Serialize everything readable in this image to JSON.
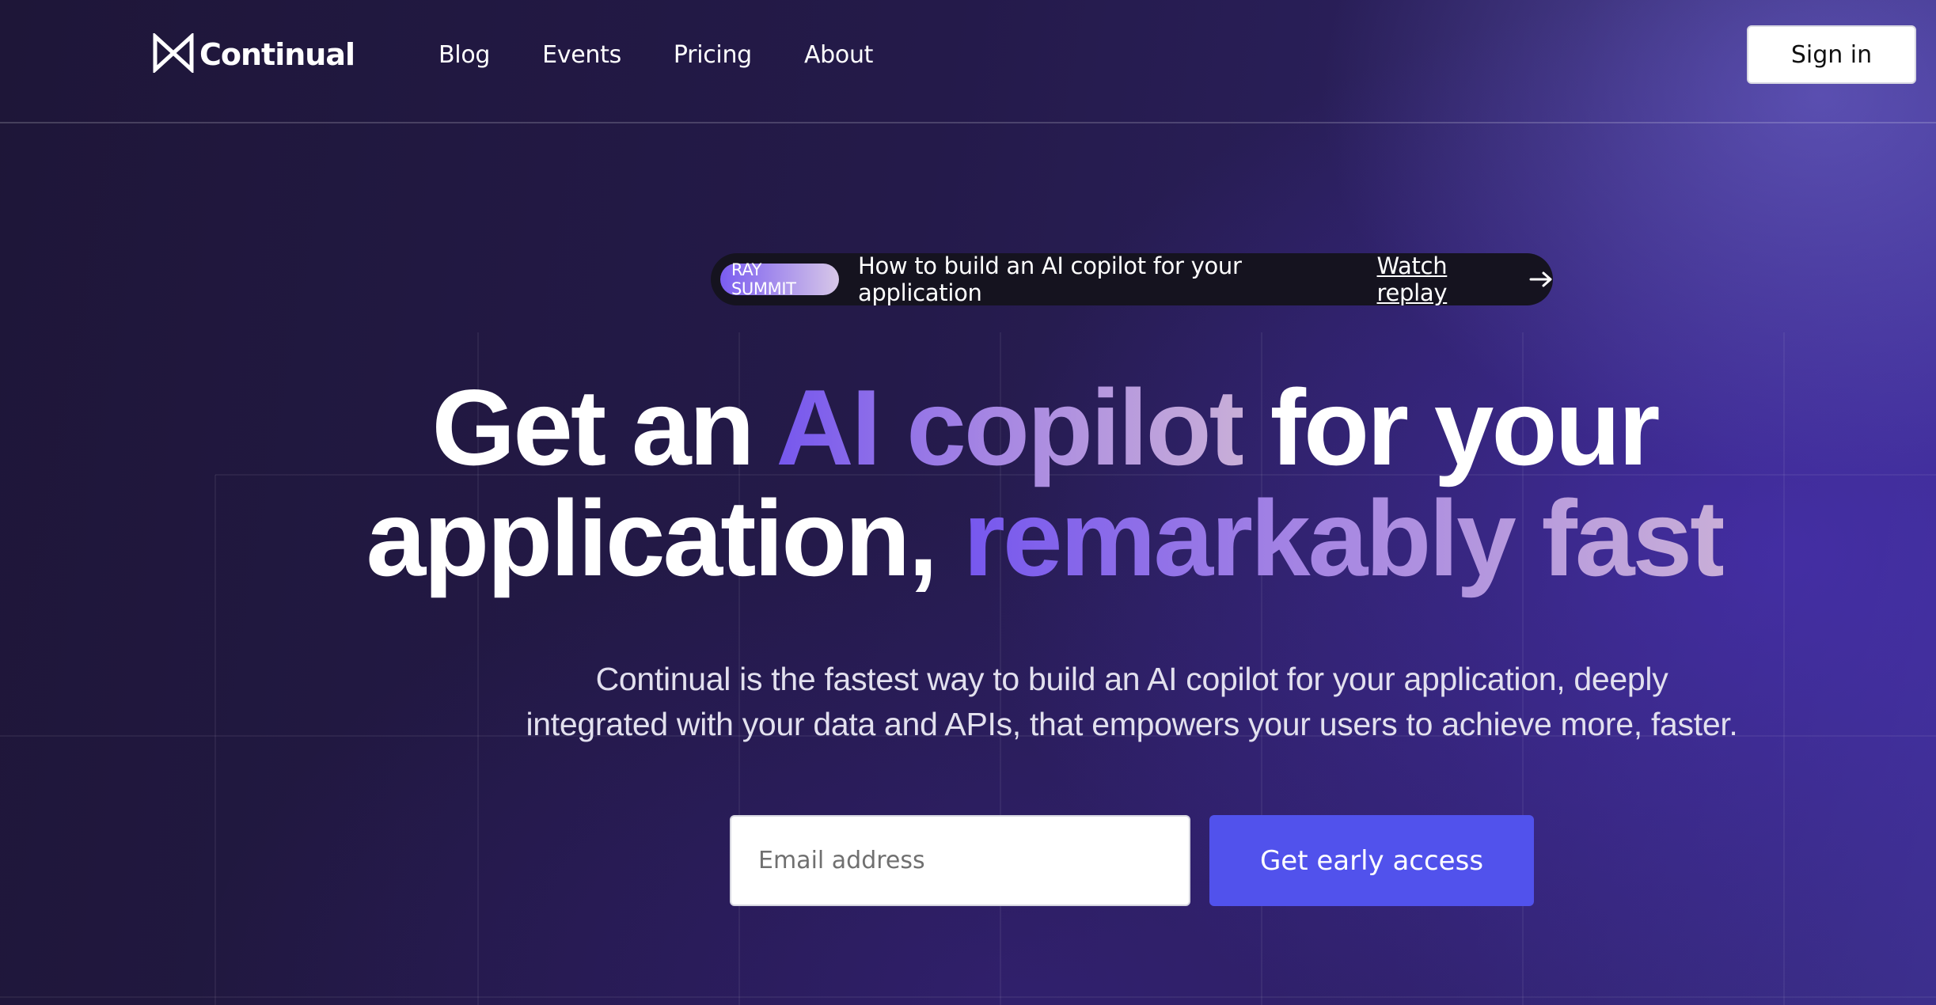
{
  "header": {
    "logo_text": "Continual",
    "logo_icon": "bowtie-logo-icon",
    "nav": [
      {
        "label": "Blog"
      },
      {
        "label": "Events"
      },
      {
        "label": "Pricing"
      },
      {
        "label": "About"
      }
    ],
    "signin_label": "Sign in"
  },
  "banner": {
    "badge": "RAY SUMMIT",
    "text": "How to build an AI copilot for your application",
    "link": "Watch replay",
    "link_icon": "arrow-right-icon"
  },
  "hero": {
    "title_part1": "Get an ",
    "title_highlight1": "AI copilot",
    "title_part2": " for your",
    "title_part3": "application, ",
    "title_highlight2": "remarkably fast",
    "subtitle_line1": "Continual is the fastest way to build an AI copilot for your application, deeply",
    "subtitle_line2": "integrated with your data and APIs, that empowers your users to achieve more, faster."
  },
  "signup": {
    "email_placeholder": "Email address",
    "email_value": "",
    "cta_label": "Get early access"
  },
  "colors": {
    "accent": "#5152ec",
    "gradient_start": "#7657ee",
    "gradient_end": "#c8aed8",
    "background_dark": "#1e1638"
  }
}
